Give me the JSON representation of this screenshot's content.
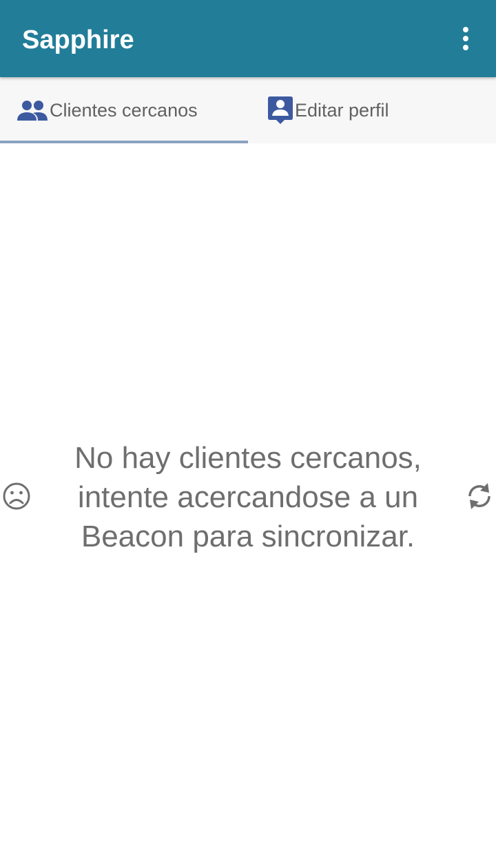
{
  "app_bar": {
    "title": "Sapphire",
    "background_color": "#227d98",
    "overflow_icon": "more-vert-icon"
  },
  "tabs": [
    {
      "label": "Clientes cercanos",
      "icon": "people-icon",
      "selected": true
    },
    {
      "label": "Editar perfil",
      "icon": "person-pin-icon",
      "selected": false
    }
  ],
  "empty_state": {
    "message": "No hay clientes cercanos, intente acercandose a un Beacon para sincronizar.",
    "left_icon": "sad-face-icon",
    "right_icon": "refresh-icon"
  },
  "colors": {
    "accent_icon": "#3d5aa0",
    "tab_indicator": "#8aa2c2",
    "text_secondary": "#6e6e6e"
  }
}
